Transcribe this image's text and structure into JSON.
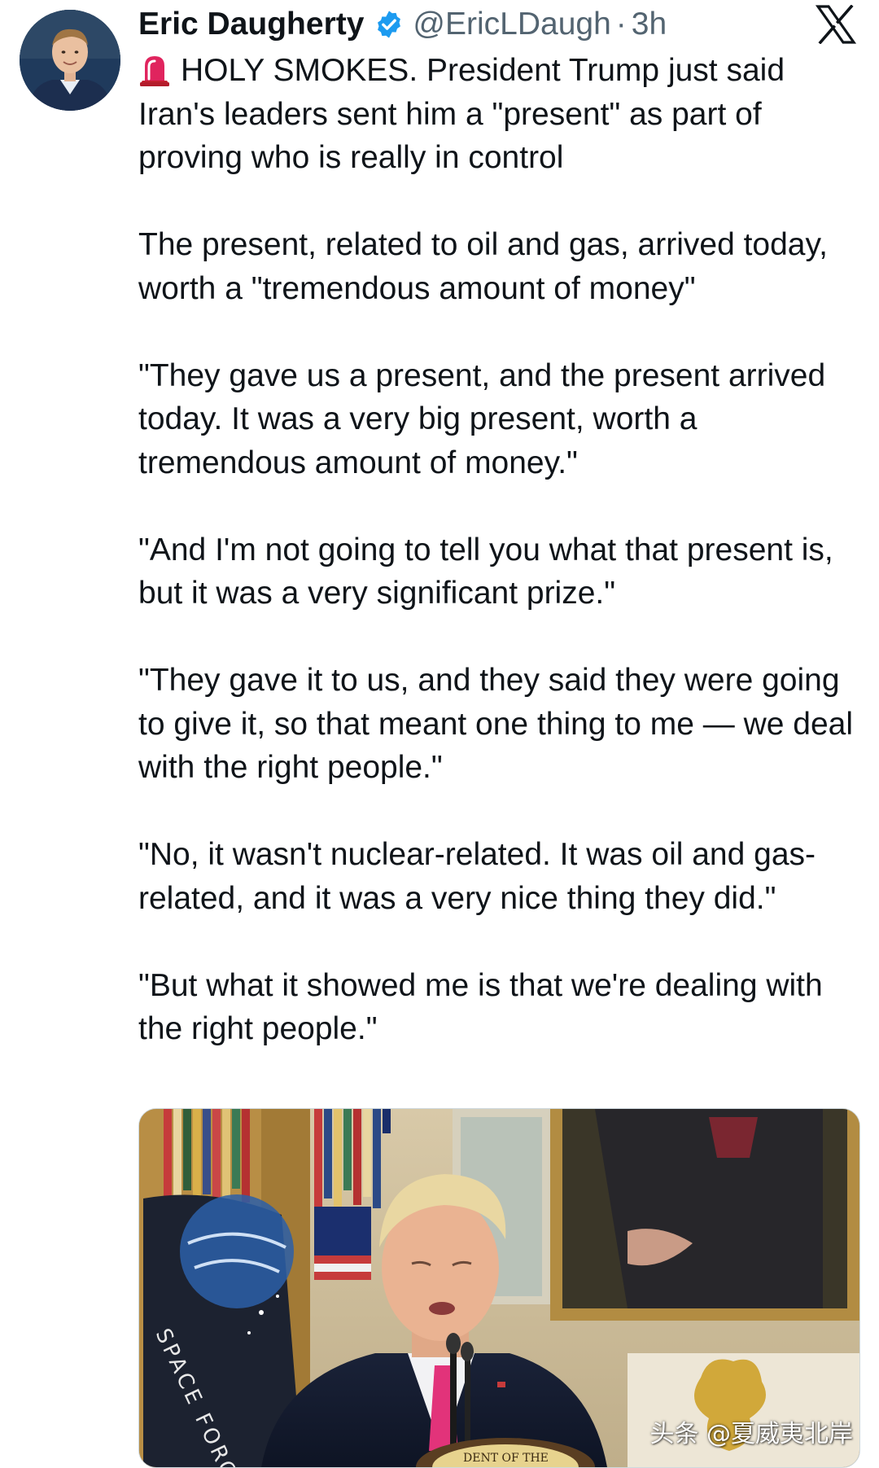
{
  "tweet": {
    "author_name": "Eric Daugherty",
    "handle": "@EricLDaugh",
    "separator": "·",
    "timestamp": "3h",
    "verified": true,
    "platform_logo": "x-logo",
    "paragraphs": [
      "HOLY SMOKES. President Trump just said Iran's leaders sent him a \"present\" as part of proving who is really in control",
      "The present, related to oil and gas, arrived today, worth a \"tremendous amount of money\"",
      "\"They gave us a present, and the present arrived today. It was a very big present, worth a tremendous amount of money.\"",
      "\"And I'm not going to tell you what that present is, but it was a very significant prize.\"",
      "\"They gave it to us, and they said they were going to give it, so that meant one thing to me — we deal with the right people.\"",
      "\"No, it wasn't nuclear-related. It was oil and gas-related, and it was a very nice thing they did.\"",
      "\"But what it showed me is that we're dealing with the right people.\""
    ],
    "leading_icon": "rotating-light-icon"
  },
  "media": {
    "flag_text": "SPACE FORCE",
    "seal_text": "DENT OF THE",
    "watermark": "头条 @夏威夷北岸"
  },
  "colors": {
    "text_primary": "#0f1419",
    "text_secondary": "#536471",
    "verified_blue": "#1d9bf0",
    "alert_red": "#e0245e",
    "tie_pink": "#e2337a"
  }
}
